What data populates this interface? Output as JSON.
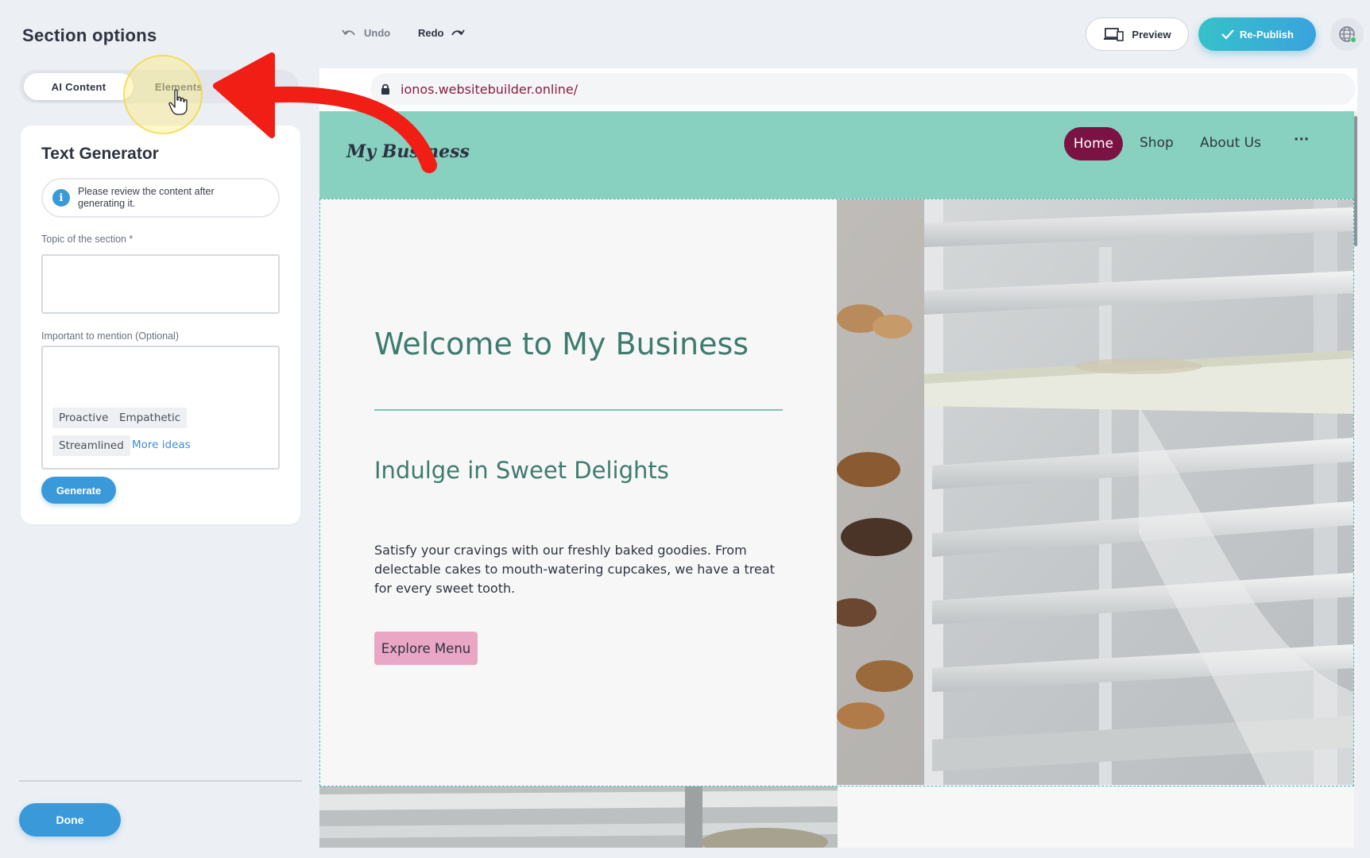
{
  "left_panel": {
    "title": "Section options",
    "tabs": [
      {
        "label": "AI Content",
        "active": true
      },
      {
        "label": "Elements",
        "active": false
      }
    ],
    "card": {
      "title": "Text Generator",
      "info": "Please review the content after generating it.",
      "topic_label": "Topic of the section *",
      "topic_value": "",
      "important_label": "Important to mention (Optional)",
      "important_value": "",
      "chips": [
        "Proactive",
        "Empathetic",
        "Streamlined"
      ],
      "more_ideas": "More ideas",
      "generate_label": "Generate"
    },
    "done_label": "Done"
  },
  "toolbar": {
    "undo_label": "Undo",
    "redo_label": "Redo",
    "preview_label": "Preview",
    "republish_label": "Re-Publish",
    "globe_icon": "globe-icon"
  },
  "browser": {
    "url": "ionos.websitebuilder.online/",
    "lock_icon": "lock-icon"
  },
  "site": {
    "logo": "My Business",
    "nav": [
      "Home",
      "Shop",
      "About Us",
      "···"
    ],
    "hero_title": "Welcome to My Business",
    "hero_subtitle": "Indulge in Sweet Delights",
    "hero_text": "Satisfy your cravings with our freshly baked goodies. From delectable cakes to mouth-watering cupcakes, we have a treat for every sweet tooth.",
    "cta_label": "Explore Menu"
  },
  "colors": {
    "accent_blue": "#3a9ad9",
    "republish_teal": "#35c1c9",
    "header_mint": "#88d1c1",
    "nav_active": "#7a1244",
    "heading_green": "#3e7b6f",
    "cta_pink": "#eaa7c5",
    "annotation_red": "#f01e14",
    "highlight_yellow": "#ffeb6e"
  }
}
